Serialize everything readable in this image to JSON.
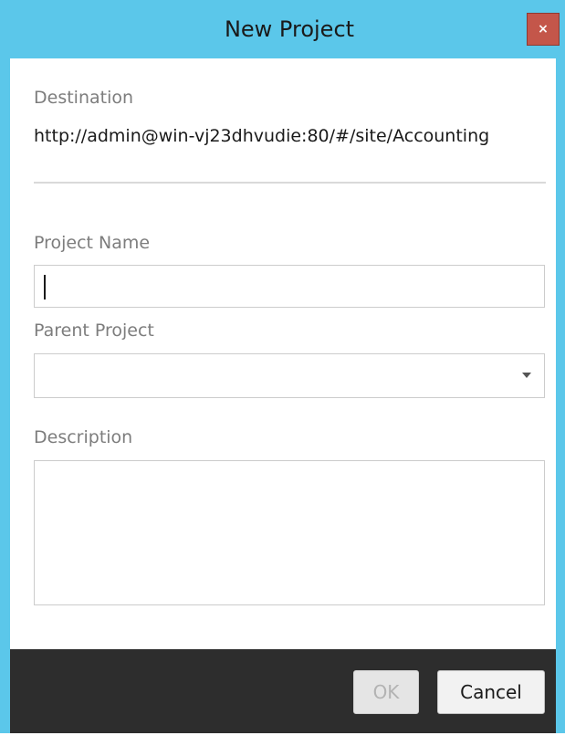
{
  "window": {
    "title": "New Project",
    "close_label": "×",
    "accent_color": "#5bc7ea",
    "close_color": "#c4564a",
    "footer_color": "#2d2d2d"
  },
  "form": {
    "destination_label": "Destination",
    "destination_value": "http://admin@win-vj23dhvudie:80/#/site/Accounting",
    "project_name_label": "Project Name",
    "project_name_value": "",
    "parent_project_label": "Parent Project",
    "parent_project_value": "",
    "description_label": "Description",
    "description_value": ""
  },
  "footer": {
    "ok_label": "OK",
    "cancel_label": "Cancel",
    "ok_enabled": false
  }
}
